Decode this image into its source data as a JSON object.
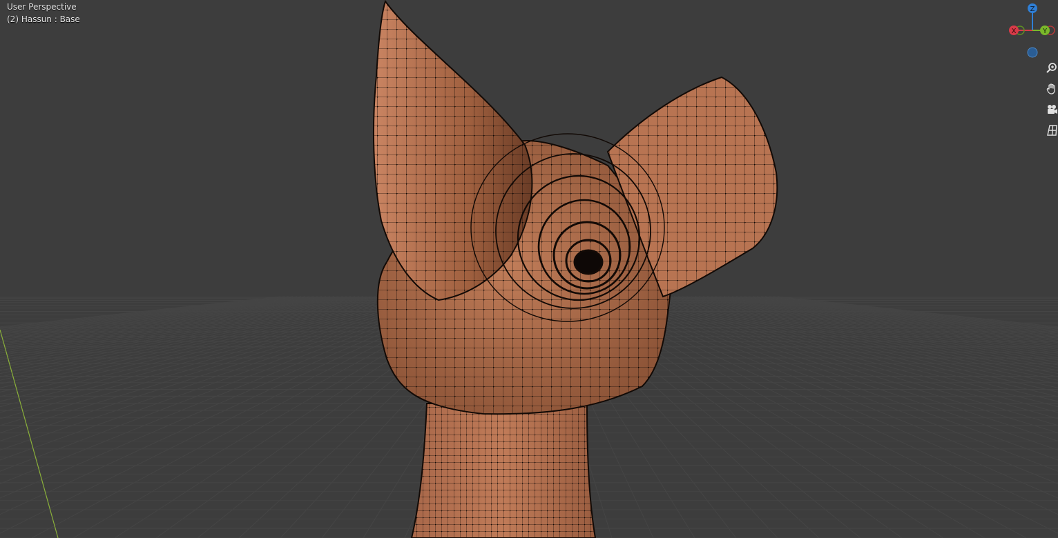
{
  "viewport": {
    "view_name": "User Perspective",
    "object_info": "(2) Hassun : Base",
    "background_color": "#3d3d3d",
    "grid_color": "#454545",
    "y_axis_line_color": "#8ab03a",
    "mesh_color": "#b2714f",
    "wire_color": "#1a0f0a"
  },
  "gizmo": {
    "axes": [
      {
        "label": "Z",
        "color": "#2f7fd6"
      },
      {
        "label": "Y",
        "color": "#7ab82a"
      },
      {
        "label": "X",
        "color": "#d83a48"
      }
    ],
    "neg_z_color": "#2a5d94"
  },
  "nav_tools": [
    {
      "name": "zoom-icon"
    },
    {
      "name": "hand-pan-icon"
    },
    {
      "name": "camera-icon"
    },
    {
      "name": "ortho-grid-icon"
    }
  ]
}
